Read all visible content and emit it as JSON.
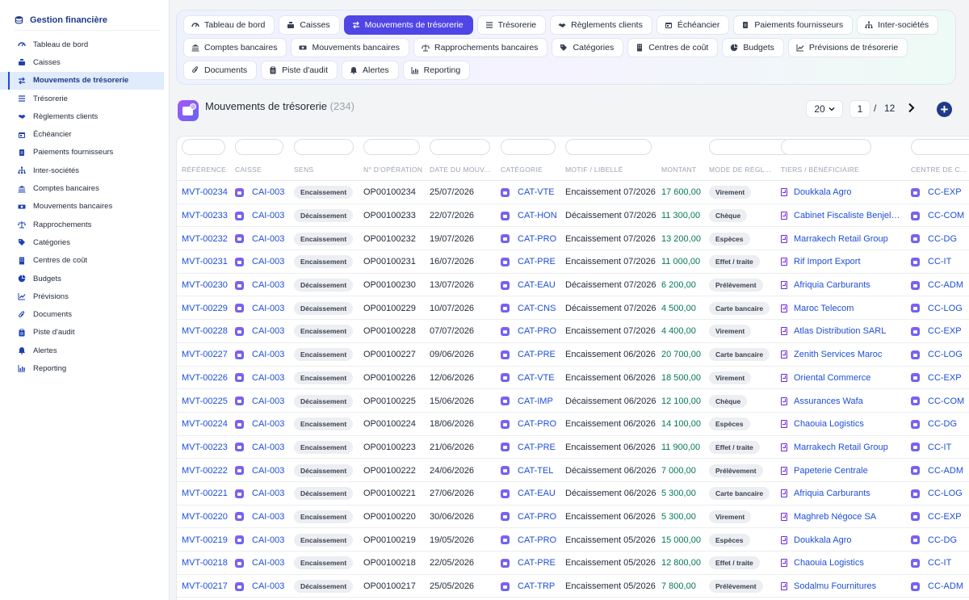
{
  "sidebar": {
    "title": "Gestion financière",
    "items": [
      {
        "label": "Tableau de bord",
        "icon": "dashboard-icon"
      },
      {
        "label": "Caisses",
        "icon": "cash-register-icon"
      },
      {
        "label": "Mouvements de trésorerie",
        "icon": "exchange-icon",
        "active": true
      },
      {
        "label": "Trésorerie",
        "icon": "list-icon"
      },
      {
        "label": "Règlements clients",
        "icon": "handshake-icon"
      },
      {
        "label": "Échéancier",
        "icon": "calendar-icon"
      },
      {
        "label": "Paiements fournisseurs",
        "icon": "invoice-icon"
      },
      {
        "label": "Inter-sociétés",
        "icon": "sitemap-icon"
      },
      {
        "label": "Comptes bancaires",
        "icon": "bank-icon"
      },
      {
        "label": "Mouvements bancaires",
        "icon": "money-icon"
      },
      {
        "label": "Rapprochements",
        "icon": "scale-icon"
      },
      {
        "label": "Catégories",
        "icon": "tags-icon"
      },
      {
        "label": "Centres de coût",
        "icon": "building-icon"
      },
      {
        "label": "Budgets",
        "icon": "pie-icon"
      },
      {
        "label": "Prévisions",
        "icon": "chart-line-icon"
      },
      {
        "label": "Documents",
        "icon": "paperclip-icon"
      },
      {
        "label": "Piste d'audit",
        "icon": "clipboard-icon"
      },
      {
        "label": "Alertes",
        "icon": "bell-icon"
      },
      {
        "label": "Reporting",
        "icon": "chart-icon"
      }
    ]
  },
  "tabs": [
    {
      "label": "Tableau de bord",
      "icon": "dashboard-icon"
    },
    {
      "label": "Caisses",
      "icon": "cash-register-icon"
    },
    {
      "label": "Mouvements de trésorerie",
      "icon": "exchange-icon",
      "active": true
    },
    {
      "label": "Trésorerie",
      "icon": "list-icon"
    },
    {
      "label": "Règlements clients",
      "icon": "handshake-icon"
    },
    {
      "label": "Échéancier",
      "icon": "calendar-icon"
    },
    {
      "label": "Paiements fournisseurs",
      "icon": "invoice-icon"
    },
    {
      "label": "Inter-sociétés",
      "icon": "sitemap-icon"
    },
    {
      "label": "Comptes bancaires",
      "icon": "bank-icon"
    },
    {
      "label": "Mouvements bancaires",
      "icon": "money-icon"
    },
    {
      "label": "Rapprochements bancaires",
      "icon": "scale-icon"
    },
    {
      "label": "Catégories",
      "icon": "tags-icon"
    },
    {
      "label": "Centres de coût",
      "icon": "building-icon"
    },
    {
      "label": "Budgets",
      "icon": "pie-icon"
    },
    {
      "label": "Prévisions de trésorerie",
      "icon": "chart-line-icon"
    },
    {
      "label": "Documents",
      "icon": "paperclip-icon"
    },
    {
      "label": "Piste d'audit",
      "icon": "clipboard-icon"
    },
    {
      "label": "Alertes",
      "icon": "bell-icon"
    },
    {
      "label": "Reporting",
      "icon": "chart-icon"
    }
  ],
  "header": {
    "title": "Mouvements de trésorerie",
    "count": "(234)",
    "page_size": "20",
    "page": "1",
    "page_separator": "/",
    "total_pages": "12"
  },
  "table": {
    "columns": [
      "RÉFÉRENCE",
      "CAISSE",
      "SENS",
      "N° D'OPÉRATION",
      "DATE DU MOUV...",
      "CATÉGORIE",
      "MOTIF / LIBELLÉ",
      "MONTANT",
      "MODE DE RÈGL...",
      "TIERS / BÉNÉFICIAIRE",
      "CENTRE DE C..."
    ],
    "rows": [
      {
        "ref": "MVT-00234",
        "caisse": "CAI-003",
        "sens": "Encaissement",
        "op": "OP00100234",
        "date": "25/07/2026",
        "cat": "CAT-VTE",
        "motif": "Encaissement 07/2026",
        "montant": "17 600,00",
        "mode": "Virement",
        "tiers": "Doukkala Agro",
        "centre": "CC-EXP"
      },
      {
        "ref": "MVT-00233",
        "caisse": "CAI-003",
        "sens": "Décaissement",
        "op": "OP00100233",
        "date": "22/07/2026",
        "cat": "CAT-HON",
        "motif": "Décaissement 07/2026",
        "montant": "11 300,00",
        "mode": "Chèque",
        "tiers": "Cabinet Fiscaliste Benjelloun",
        "centre": "CC-COM"
      },
      {
        "ref": "MVT-00232",
        "caisse": "CAI-003",
        "sens": "Encaissement",
        "op": "OP00100232",
        "date": "19/07/2026",
        "cat": "CAT-PRO",
        "motif": "Encaissement 07/2026",
        "montant": "13 200,00",
        "mode": "Espèces",
        "tiers": "Marrakech Retail Group",
        "centre": "CC-DG"
      },
      {
        "ref": "MVT-00231",
        "caisse": "CAI-003",
        "sens": "Encaissement",
        "op": "OP00100231",
        "date": "16/07/2026",
        "cat": "CAT-PRE",
        "motif": "Encaissement 07/2026",
        "montant": "11 000,00",
        "mode": "Effet / traite",
        "tiers": "Rif Import Export",
        "centre": "CC-IT"
      },
      {
        "ref": "MVT-00230",
        "caisse": "CAI-003",
        "sens": "Décaissement",
        "op": "OP00100230",
        "date": "13/07/2026",
        "cat": "CAT-EAU",
        "motif": "Décaissement 07/2026",
        "montant": "6 200,00",
        "mode": "Prélèvement",
        "tiers": "Afriquia Carburants",
        "centre": "CC-ADM"
      },
      {
        "ref": "MVT-00229",
        "caisse": "CAI-003",
        "sens": "Décaissement",
        "op": "OP00100229",
        "date": "10/07/2026",
        "cat": "CAT-CNS",
        "motif": "Décaissement 07/2026",
        "montant": "4 500,00",
        "mode": "Carte bancaire",
        "tiers": "Maroc Telecom",
        "centre": "CC-LOG"
      },
      {
        "ref": "MVT-00228",
        "caisse": "CAI-003",
        "sens": "Encaissement",
        "op": "OP00100228",
        "date": "07/07/2026",
        "cat": "CAT-PRO",
        "motif": "Encaissement 07/2026",
        "montant": "4 400,00",
        "mode": "Virement",
        "tiers": "Atlas Distribution SARL",
        "centre": "CC-EXP"
      },
      {
        "ref": "MVT-00227",
        "caisse": "CAI-003",
        "sens": "Encaissement",
        "op": "OP00100227",
        "date": "09/06/2026",
        "cat": "CAT-PRE",
        "motif": "Encaissement 06/2026",
        "montant": "20 700,00",
        "mode": "Carte bancaire",
        "tiers": "Zenith Services Maroc",
        "centre": "CC-LOG"
      },
      {
        "ref": "MVT-00226",
        "caisse": "CAI-003",
        "sens": "Encaissement",
        "op": "OP00100226",
        "date": "12/06/2026",
        "cat": "CAT-VTE",
        "motif": "Encaissement 06/2026",
        "montant": "18 500,00",
        "mode": "Virement",
        "tiers": "Oriental Commerce",
        "centre": "CC-EXP"
      },
      {
        "ref": "MVT-00225",
        "caisse": "CAI-003",
        "sens": "Décaissement",
        "op": "OP00100225",
        "date": "15/06/2026",
        "cat": "CAT-IMP",
        "motif": "Décaissement 06/2026",
        "montant": "12 100,00",
        "mode": "Chèque",
        "tiers": "Assurances Wafa",
        "centre": "CC-COM"
      },
      {
        "ref": "MVT-00224",
        "caisse": "CAI-003",
        "sens": "Encaissement",
        "op": "OP00100224",
        "date": "18/06/2026",
        "cat": "CAT-PRO",
        "motif": "Encaissement 06/2026",
        "montant": "14 100,00",
        "mode": "Espèces",
        "tiers": "Chaouia Logistics",
        "centre": "CC-DG"
      },
      {
        "ref": "MVT-00223",
        "caisse": "CAI-003",
        "sens": "Encaissement",
        "op": "OP00100223",
        "date": "21/06/2026",
        "cat": "CAT-PRE",
        "motif": "Encaissement 06/2026",
        "montant": "11 900,00",
        "mode": "Effet / traite",
        "tiers": "Marrakech Retail Group",
        "centre": "CC-IT"
      },
      {
        "ref": "MVT-00222",
        "caisse": "CAI-003",
        "sens": "Décaissement",
        "op": "OP00100222",
        "date": "24/06/2026",
        "cat": "CAT-TEL",
        "motif": "Décaissement 06/2026",
        "montant": "7 000,00",
        "mode": "Prélèvement",
        "tiers": "Papeterie Centrale",
        "centre": "CC-ADM"
      },
      {
        "ref": "MVT-00221",
        "caisse": "CAI-003",
        "sens": "Décaissement",
        "op": "OP00100221",
        "date": "27/06/2026",
        "cat": "CAT-EAU",
        "motif": "Décaissement 06/2026",
        "montant": "5 300,00",
        "mode": "Carte bancaire",
        "tiers": "Afriquia Carburants",
        "centre": "CC-LOG"
      },
      {
        "ref": "MVT-00220",
        "caisse": "CAI-003",
        "sens": "Encaissement",
        "op": "OP00100220",
        "date": "30/06/2026",
        "cat": "CAT-PRO",
        "motif": "Encaissement 06/2026",
        "montant": "5 300,00",
        "mode": "Virement",
        "tiers": "Maghreb Négoce SA",
        "centre": "CC-EXP"
      },
      {
        "ref": "MVT-00219",
        "caisse": "CAI-003",
        "sens": "Encaissement",
        "op": "OP00100219",
        "date": "19/05/2026",
        "cat": "CAT-PRO",
        "motif": "Encaissement 05/2026",
        "montant": "15 000,00",
        "mode": "Espèces",
        "tiers": "Doukkala Agro",
        "centre": "CC-DG"
      },
      {
        "ref": "MVT-00218",
        "caisse": "CAI-003",
        "sens": "Encaissement",
        "op": "OP00100218",
        "date": "22/05/2026",
        "cat": "CAT-PRE",
        "motif": "Encaissement 05/2026",
        "montant": "12 800,00",
        "mode": "Effet / traite",
        "tiers": "Chaouia Logistics",
        "centre": "CC-IT"
      },
      {
        "ref": "MVT-00217",
        "caisse": "CAI-003",
        "sens": "Décaissement",
        "op": "OP00100217",
        "date": "25/05/2026",
        "cat": "CAT-TRP",
        "motif": "Encaissement 05/2026",
        "montant": "7 800,00",
        "mode": "Prélèvement",
        "tiers": "Sodalmu Fournitures",
        "centre": "CC-ADM"
      }
    ]
  },
  "colors": {
    "accent": "#4f46e5",
    "link": "#1d4ed8",
    "amount": "#047857",
    "sidebar_active_bg": "#e0ebfb"
  }
}
